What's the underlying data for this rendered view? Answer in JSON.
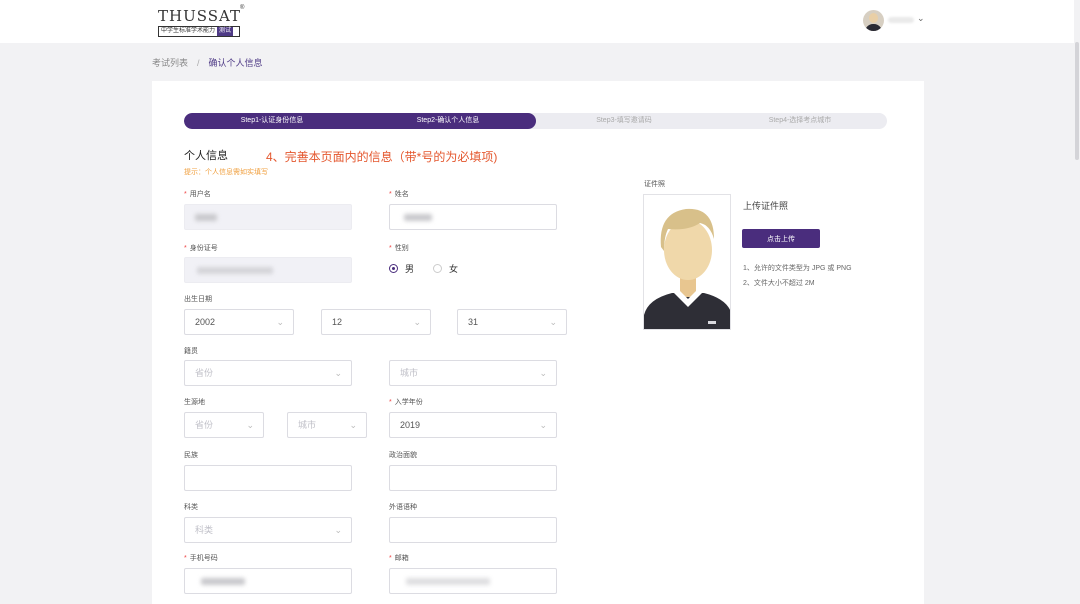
{
  "header": {
    "logo_text": "THUSSAT",
    "logo_reg": "®",
    "logo_sub_a": "中学生标准学术能力",
    "logo_sub_b": "测试"
  },
  "breadcrumb": {
    "parent": "考试列表",
    "separator": "/",
    "current": "确认个人信息"
  },
  "steps": [
    {
      "label": "Step1-认证身份信息",
      "state": "done"
    },
    {
      "label": "Step2-确认个人信息",
      "state": "current"
    },
    {
      "label": "Step3-填写邀请码",
      "state": "todo"
    },
    {
      "label": "Step4-选择考点城市",
      "state": "todo"
    }
  ],
  "section": {
    "title": "个人信息",
    "annotation": "4、完善本页面内的信息（带*号的为必填项)",
    "hint": "提示：个人信息需如实填写"
  },
  "required_mark": "*",
  "form": {
    "username": {
      "label": "用户名"
    },
    "name": {
      "label": "姓名"
    },
    "id_number": {
      "label": "身份证号"
    },
    "gender": {
      "label": "性别",
      "options": [
        "男",
        "女"
      ],
      "selected": "男"
    },
    "birth": {
      "label": "出生日期",
      "year": "2002",
      "month": "12",
      "day": "31"
    },
    "native": {
      "label": "籍贯",
      "province_placeholder": "省份",
      "city_placeholder": "城市"
    },
    "source": {
      "label": "生源地",
      "province_placeholder": "省份",
      "city_placeholder": "城市"
    },
    "enroll_year": {
      "label": "入学年份",
      "value": "2019"
    },
    "ethnicity": {
      "label": "民族",
      "value": ""
    },
    "political": {
      "label": "政治面貌",
      "value": ""
    },
    "subject": {
      "label": "科类",
      "placeholder": "科类"
    },
    "language": {
      "label": "外语语种",
      "value": ""
    },
    "phone": {
      "label": "手机号码"
    },
    "email": {
      "label": "邮箱"
    }
  },
  "photo": {
    "title": "证件照",
    "upload_title": "上传证件照",
    "upload_button": "点击上传",
    "tips": [
      "1、允许的文件类型为 JPG 或 PNG",
      "2、文件大小不超过 2M"
    ]
  },
  "colors": {
    "accent": "#4a2d7d",
    "annotation": "#e4572e",
    "hint": "#f0a040"
  }
}
